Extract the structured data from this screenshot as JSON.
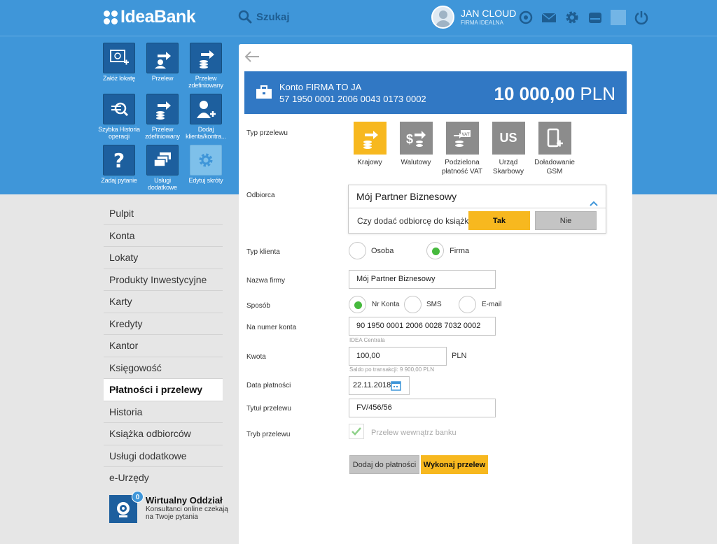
{
  "header": {
    "logo": "IdeaBank",
    "search_label": "Szukaj",
    "user_name": "JAN CLOUD",
    "company": "FIRMA IDEALNA",
    "icons": [
      "target-icon",
      "mail-icon",
      "gear-icon",
      "inbox-icon",
      "power-icon"
    ]
  },
  "tiles": [
    {
      "label": "Załóż lokatę",
      "icon": "deposit-icon"
    },
    {
      "label": "Przelew",
      "icon": "transfer-icon"
    },
    {
      "label": "Przelew zdefiniowany",
      "icon": "defined-transfer-icon"
    },
    {
      "label": "Szybka Historia operacji",
      "icon": "history-search-icon"
    },
    {
      "label": "Przelew zdefiniowany",
      "icon": "defined-transfer-icon"
    },
    {
      "label": "Dodaj klienta/kontra...",
      "icon": "add-user-icon"
    },
    {
      "label": "Zadaj pytanie",
      "icon": "question-icon"
    },
    {
      "label": "Usługi dodatkowe",
      "icon": "services-icon"
    },
    {
      "label": "Edytuj skróty",
      "icon": "gear-icon"
    }
  ],
  "menu": [
    "Pulpit",
    "Konta",
    "Lokaty",
    "Produkty Inwestycyjne",
    "Karty",
    "Kredyty",
    "Kantor",
    "Księgowość",
    "Płatności i przelewy",
    "Historia",
    "Książka odbiorców",
    "Usługi dodatkowe",
    "e-Urzędy"
  ],
  "menu_active": "Płatności i przelewy",
  "virtual_office": {
    "badge": "0",
    "title": "Wirtualny Oddział",
    "subtitle1": "Konsultanci online czekają",
    "subtitle2": "na Twoje pytania"
  },
  "account": {
    "name": "Konto FIRMA TO JA",
    "number": "57 1950 0001 2006 0043 0173 0002",
    "amount_major": "10 000,00",
    "currency": "PLN"
  },
  "form": {
    "type_label": "Typ przelewu",
    "types": [
      {
        "l1": "Krajowy",
        "l2": "",
        "selected": true
      },
      {
        "l1": "Walutowy",
        "l2": "",
        "selected": false
      },
      {
        "l1": "Podzielona",
        "l2": "płatność VAT",
        "selected": false
      },
      {
        "l1": "Urząd",
        "l2": "Skarbowy",
        "selected": false,
        "box_text": "US"
      },
      {
        "l1": "Doładowanie",
        "l2": "GSM",
        "selected": false
      }
    ],
    "recipient_label": "Odbiorca",
    "recipient_value": "Mój Partner Biznesowy",
    "add_question": "Czy dodać odbiorcę do książki?",
    "yes": "Tak",
    "no": "Nie",
    "client_type_label": "Typ klienta",
    "client_person": "Osoba",
    "client_company": "Firma",
    "company_name_label": "Nazwa firmy",
    "company_name_value": "Mój Partner Biznesowy",
    "method_label": "Sposób",
    "method_account": "Nr Konta",
    "method_sms": "SMS",
    "method_email": "E-mail",
    "account_no_label": "Na numer konta",
    "account_no_value": "90 1950 0001 2006 0028 7032 0002",
    "bank_hint": "IDEA Centrala",
    "amount_label": "Kwota",
    "amount_value": "100,00",
    "amount_currency": "PLN",
    "balance_hint": "Saldo po transakcji: 9 900,00 PLN",
    "date_label": "Data płatności",
    "date_value": "22.11.2018",
    "title_label": "Tytuł przelewu",
    "title_value": "FV/456/56",
    "mode_label": "Tryb przelewu",
    "mode_value": "Przelew wewnątrz banku",
    "add_payment_button": "Dodaj do płatności",
    "execute_button": "Wykonaj przelew"
  },
  "colors": {
    "primary": "#3f96d9",
    "dark_blue": "#1d5f9e",
    "account_blue": "#3178c4",
    "accent_yellow": "#f7b81f",
    "green": "#46b93d"
  }
}
